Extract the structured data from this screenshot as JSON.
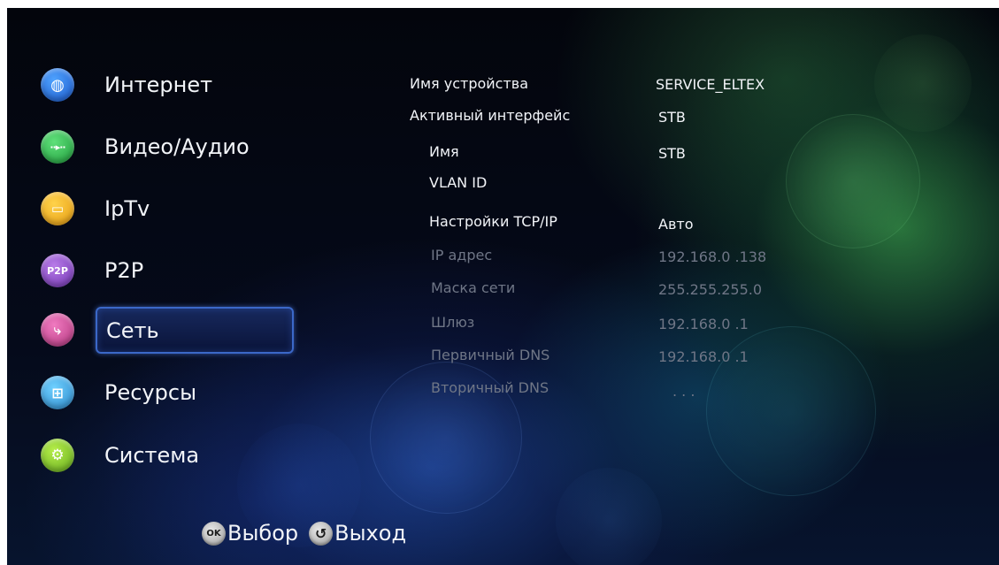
{
  "menu": {
    "items": [
      {
        "label": "Интернет",
        "icon": "globe-icon",
        "glyph": "◍"
      },
      {
        "label": "Видео/Аудио",
        "icon": "media-play-icon",
        "glyph": "··▸··"
      },
      {
        "label": "IpTv",
        "icon": "tv-screen-icon",
        "glyph": "▭"
      },
      {
        "label": "P2P",
        "icon": "p2p-icon",
        "glyph": "P2P"
      },
      {
        "label": "Сеть",
        "icon": "network-icon",
        "glyph": "⤷"
      },
      {
        "label": "Ресурсы",
        "icon": "resources-icon",
        "glyph": "⊞"
      },
      {
        "label": "Система",
        "icon": "settings-gears-icon",
        "glyph": "⚙"
      }
    ],
    "selected": "Сеть"
  },
  "network_info": {
    "rows": [
      {
        "label": "Имя устройства",
        "value": "SERVICE_ELTEX",
        "enabled": true
      },
      {
        "label": "Активный интерфейс",
        "value": "STB",
        "enabled": true
      },
      {
        "label": "Имя",
        "value": "STB",
        "enabled": true
      },
      {
        "label": "VLAN ID",
        "value": "",
        "enabled": true
      },
      {
        "label": "Настройки TCP/IP",
        "value": "Авто",
        "enabled": true
      },
      {
        "label": "IP адрес",
        "value": "192.168.0 .138",
        "enabled": false
      },
      {
        "label": "Маска сети",
        "value": "255.255.255.0",
        "enabled": false
      },
      {
        "label": "Шлюз",
        "value": "192.168.0 .1",
        "enabled": false
      },
      {
        "label": "Первичный DNS",
        "value": "192.168.0 .1",
        "enabled": false
      },
      {
        "label": "Вторичный DNS",
        "value": ". . .",
        "enabled": false
      }
    ]
  },
  "hints": {
    "ok_glyph": "OK",
    "ok_label": "Выбор",
    "back_glyph": "↺",
    "back_label": "Выход"
  },
  "colors": {
    "selection_border": "#3b68c8",
    "text": "#f2f4f8",
    "disabled_text": "#6f7686"
  }
}
